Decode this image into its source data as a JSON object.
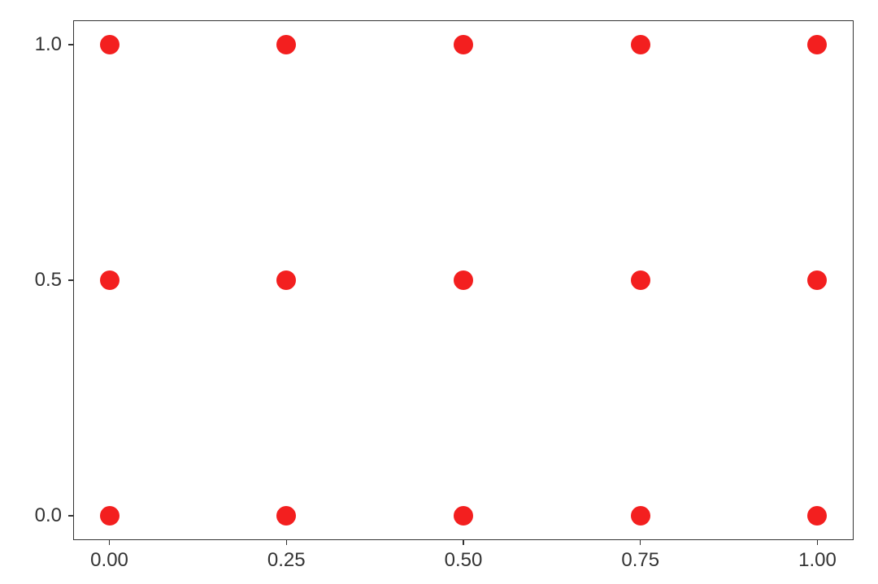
{
  "chart_data": {
    "type": "scatter",
    "x": [
      0.0,
      0.25,
      0.5,
      0.75,
      1.0,
      0.0,
      0.25,
      0.5,
      0.75,
      1.0,
      0.0,
      0.25,
      0.5,
      0.75,
      1.0
    ],
    "y": [
      0.0,
      0.0,
      0.0,
      0.0,
      0.0,
      0.5,
      0.5,
      0.5,
      0.5,
      0.5,
      1.0,
      1.0,
      1.0,
      1.0,
      1.0
    ],
    "marker_color": "#f31f1f",
    "x_ticks": [
      0.0,
      0.25,
      0.5,
      0.75,
      1.0
    ],
    "x_tick_labels": [
      "0.00",
      "0.25",
      "0.50",
      "0.75",
      "1.00"
    ],
    "y_ticks": [
      0.0,
      0.5,
      1.0
    ],
    "y_tick_labels": [
      "0.0",
      "0.5",
      "1.0"
    ],
    "xlim": [
      -0.05,
      1.05
    ],
    "ylim": [
      -0.05,
      1.05
    ],
    "title": "",
    "xlabel": "",
    "ylabel": ""
  }
}
